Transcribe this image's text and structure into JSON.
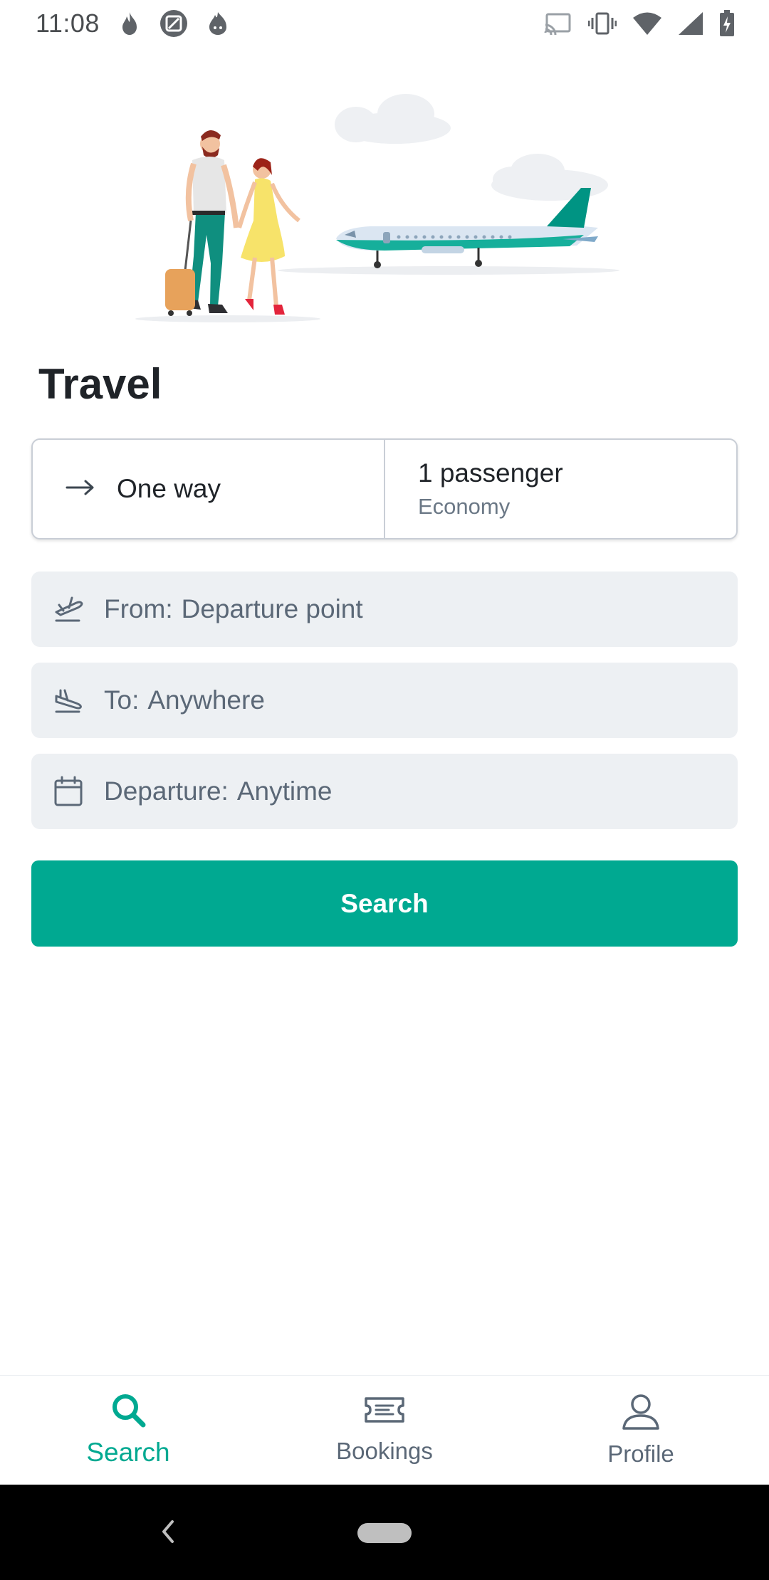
{
  "status_bar": {
    "time": "11:08",
    "notification_icons": [
      "flame-icon",
      "image-app-icon",
      "fire-face-icon"
    ],
    "system_icons": [
      "cast-icon",
      "vibrate-icon",
      "wifi-icon",
      "signal-icon",
      "battery-charging-icon"
    ]
  },
  "page": {
    "title": "Travel"
  },
  "trip": {
    "type_label": "One way",
    "passengers_label": "1 passenger",
    "cabin_class": "Economy"
  },
  "fields": {
    "from_label": "From:",
    "from_placeholder": "Departure point",
    "to_label": "To:",
    "to_placeholder": "Anywhere",
    "departure_label": "Departure:",
    "departure_placeholder": "Anytime"
  },
  "search_button": {
    "label": "Search"
  },
  "bottom_nav": {
    "items": [
      {
        "label": "Search",
        "icon": "search-icon",
        "active": true
      },
      {
        "label": "Bookings",
        "icon": "ticket-icon",
        "active": false
      },
      {
        "label": "Profile",
        "icon": "user-icon",
        "active": false
      }
    ]
  },
  "colors": {
    "accent": "#00a991",
    "field_bg": "#edf0f3",
    "muted_text": "#5b6877"
  }
}
